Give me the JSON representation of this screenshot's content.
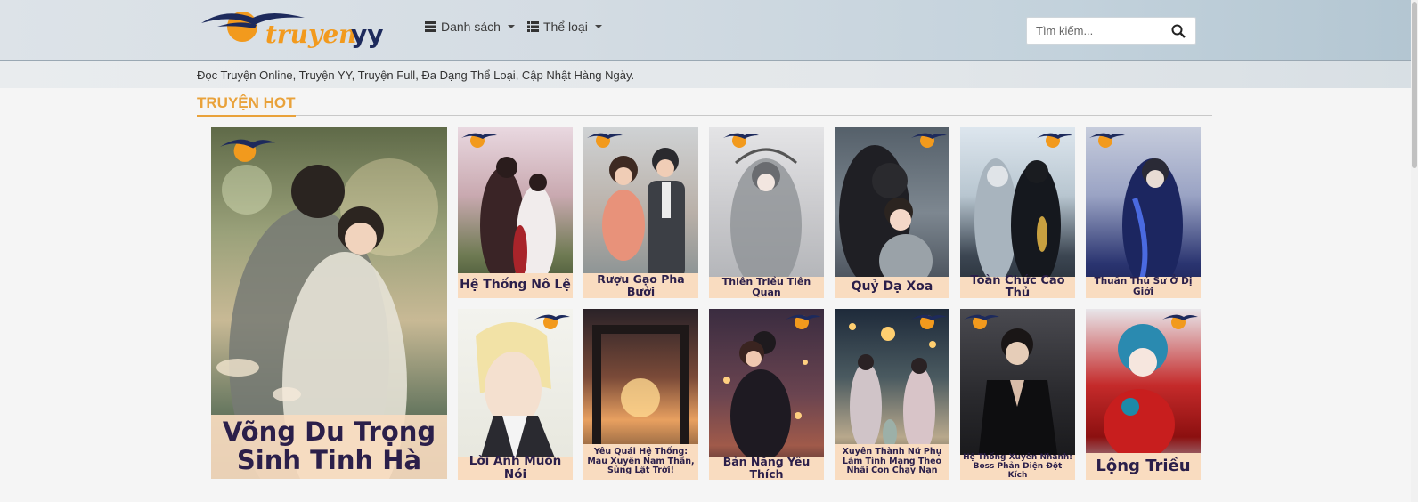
{
  "header": {
    "logo_text": "truyenyy",
    "nav": [
      {
        "label": "Danh sách",
        "icon": "list-icon"
      },
      {
        "label": "Thể loại",
        "icon": "list-icon"
      }
    ],
    "search": {
      "placeholder": "Tìm kiếm...",
      "value": "",
      "icon": "search-icon"
    }
  },
  "tagline": "Đọc Truyện Online, Truyện YY, Truyện Full, Đa Dạng Thể Loại, Cập Nhật Hàng Ngày.",
  "section": {
    "title": "TRUYỆN HOT"
  },
  "featured": {
    "title": "Võng Du Trọng Sinh Tinh Hà"
  },
  "stories": [
    {
      "title": "Hệ Thống Nô Lệ"
    },
    {
      "title": "Rượu Gạo Pha Bưởi"
    },
    {
      "title": "Thiên Triều Tiên Quan"
    },
    {
      "title": "Quỷ Dạ Xoa"
    },
    {
      "title": "Toàn Chức Cao Thủ"
    },
    {
      "title": "Thuần Thú Sư Ở Dị Giới"
    },
    {
      "title": "Lời Anh Muốn Nói"
    },
    {
      "title": "Yêu Quái Hệ Thống: Mau Xuyên Nam Thần, Sủng Lật Trời!"
    },
    {
      "title": "Bản Năng Yêu Thích"
    },
    {
      "title": "Xuyên Thành Nữ Phụ Làm Tình Mạng Theo Nhãi Con Chạy Nạn"
    },
    {
      "title": "Hệ Thống Xuyên Nhanh: Boss Phản Diện Đột Kích"
    },
    {
      "title": "Lộng Triều"
    }
  ],
  "colors": {
    "accent": "#e9a23b",
    "caption_bg": "#f9dcc0",
    "caption_text": "#2b1f4a"
  }
}
